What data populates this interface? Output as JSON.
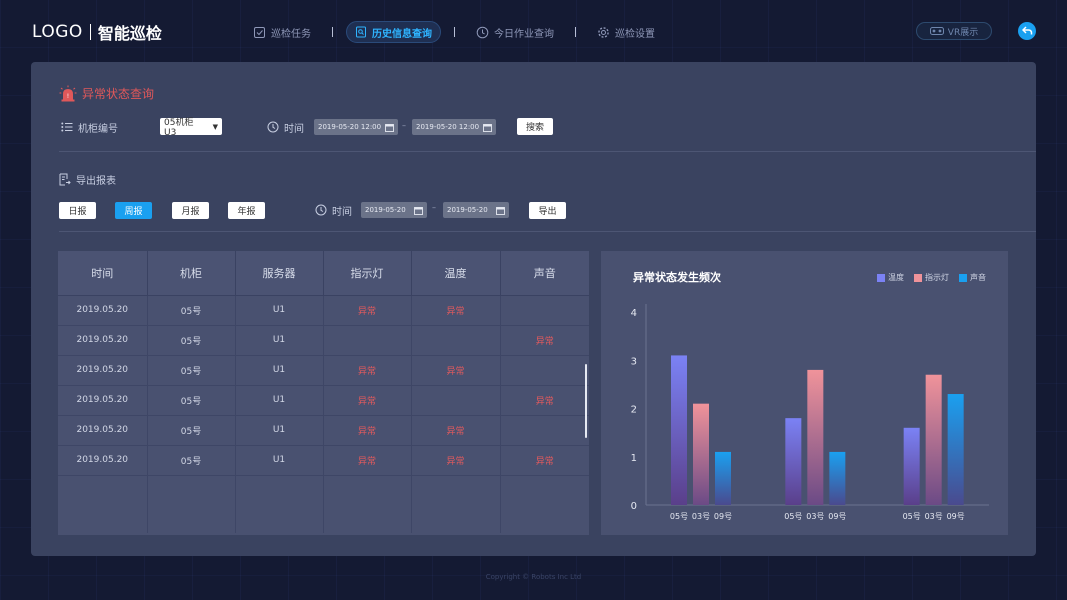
{
  "header": {
    "logo": "LOGO",
    "app_title": "智能巡检",
    "nav": [
      {
        "label": "巡检任务",
        "icon": "checklist-icon",
        "active": false
      },
      {
        "label": "历史信息查询",
        "icon": "search-doc-icon",
        "active": true
      },
      {
        "label": "今日作业查询",
        "icon": "clock-icon",
        "active": false
      },
      {
        "label": "巡检设置",
        "icon": "gear-icon",
        "active": false
      }
    ],
    "vr_label": "VR展示"
  },
  "query": {
    "title": "异常状态查询",
    "cabinet_label": "机柜编号",
    "cabinet_value": "05机柜 U3",
    "time_label": "时间",
    "start_time": "2019-05-20 12:00",
    "end_time": "2019-05-20 12:00",
    "search_label": "搜索"
  },
  "export": {
    "title": "导出报表",
    "periods": [
      "日报",
      "周报",
      "月报",
      "年报"
    ],
    "active_period": "周报",
    "time_label": "时间",
    "start_date": "2019-05-20",
    "end_date": "2019-05-20",
    "export_label": "导出"
  },
  "table": {
    "columns": [
      "时间",
      "机柜",
      "服务器",
      "指示灯",
      "温度",
      "声音"
    ],
    "rows": [
      [
        "2019.05.20",
        "05号",
        "U1",
        "异常",
        "异常",
        ""
      ],
      [
        "2019.05.20",
        "05号",
        "U1",
        "",
        "",
        "异常"
      ],
      [
        "2019.05.20",
        "05号",
        "U1",
        "异常",
        "异常",
        ""
      ],
      [
        "2019.05.20",
        "05号",
        "U1",
        "异常",
        "",
        "异常"
      ],
      [
        "2019.05.20",
        "05号",
        "U1",
        "异常",
        "异常",
        ""
      ],
      [
        "2019.05.20",
        "05号",
        "U1",
        "异常",
        "异常",
        "异常"
      ]
    ]
  },
  "chart_data": {
    "type": "bar",
    "title": "异常状态发生频次",
    "groups": [
      {
        "categories": [
          "05号",
          "03号",
          "09号"
        ]
      },
      {
        "categories": [
          "05号",
          "03号",
          "09号"
        ]
      },
      {
        "categories": [
          "05号",
          "03号",
          "09号"
        ]
      }
    ],
    "series": [
      {
        "name": "温度",
        "values": [
          3.1,
          1.8,
          1.6
        ]
      },
      {
        "name": "指示灯",
        "values": [
          2.1,
          2.8,
          2.7
        ]
      },
      {
        "name": "声音",
        "values": [
          1.1,
          1.1,
          2.3
        ]
      }
    ],
    "ylim": [
      0,
      4
    ],
    "yticks": [
      0,
      1,
      2,
      3,
      4
    ],
    "legend_position": "top-right",
    "colors": {
      "温度": [
        "#7b82f5",
        "#5a3f8a"
      ],
      "指示灯": [
        "#f0939a",
        "#6b4a86"
      ],
      "声音": [
        "#1aa0f0",
        "#4a4a8e"
      ]
    }
  },
  "colors": {
    "accent_blue": "#1aa0f0",
    "error_red": "#e35a5d",
    "panel_bg": "#3a4360"
  },
  "footer": "Copyright © Robots Inc Ltd"
}
